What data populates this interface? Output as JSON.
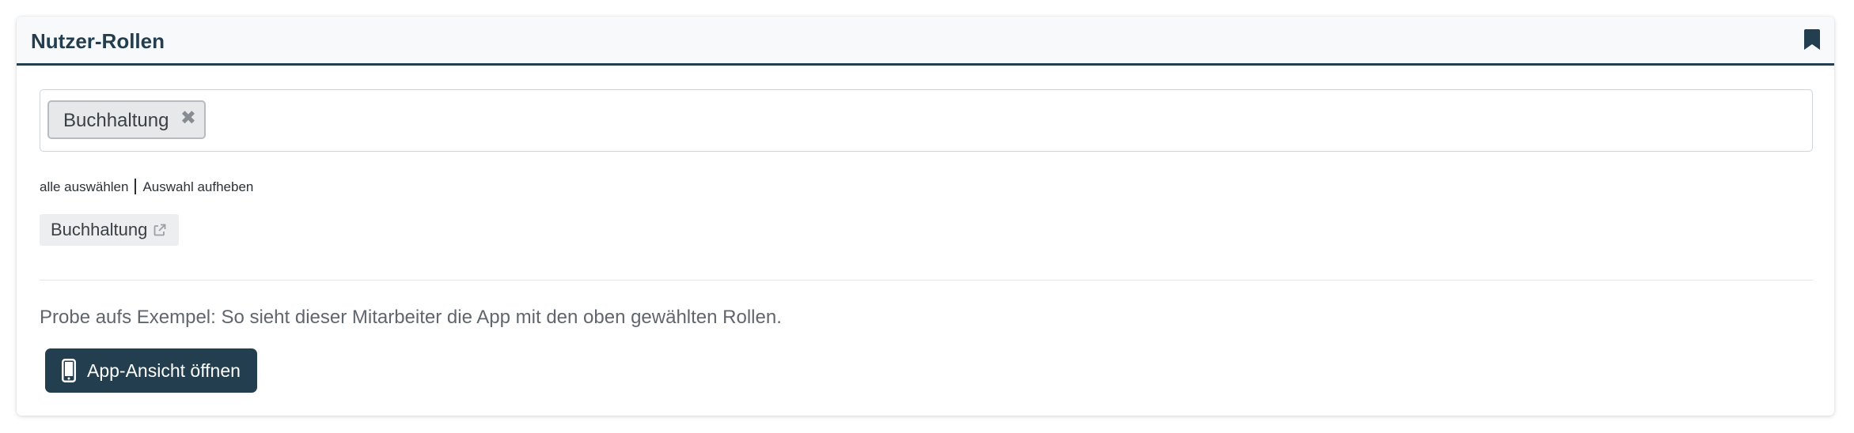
{
  "panel": {
    "title": "Nutzer-Rollen",
    "bookmark_icon": "bookmark-icon"
  },
  "role_select": {
    "selected": [
      {
        "label": "Buchhaltung",
        "remove_icon": "close-icon",
        "remove_glyph": "✖"
      }
    ],
    "select_all_label": "alle auswählen",
    "deselect_label": "Auswahl aufheben"
  },
  "role_tags": [
    {
      "label": "Buchhaltung",
      "icon": "external-link-icon"
    }
  ],
  "preview": {
    "hint": "Probe aufs Exempel: So sieht dieser Mitarbeiter die App mit den oben gewählten Rollen.",
    "button_label": "App-Ansicht öffnen",
    "button_icon": "mobile-phone-icon"
  },
  "colors": {
    "primary": "#233e4e",
    "header_bg": "#f8f9fb",
    "chip_bg": "#e7e8ea",
    "tag_bg": "#eceef0",
    "muted_text": "#5f666d"
  }
}
